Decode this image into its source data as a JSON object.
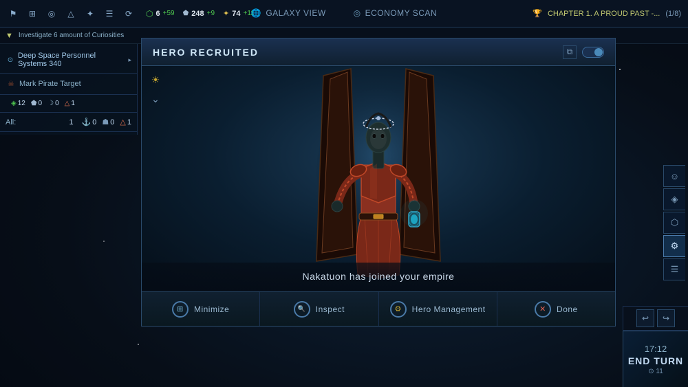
{
  "topbar": {
    "icons": [
      "⚑",
      "⊞",
      "◎",
      "△",
      "✦",
      "☰",
      "⟳"
    ],
    "resources": [
      {
        "icon": "⬡",
        "color": "#50c850",
        "value": "6",
        "delta": "+59"
      },
      {
        "icon": "⬟",
        "color": "#a0b8d0",
        "value": "248",
        "delta": "+9"
      },
      {
        "icon": "✦",
        "color": "#e0c050",
        "value": "74",
        "delta": "+11"
      }
    ],
    "nav": [
      {
        "label": "GALAXY VIEW",
        "icon": ""
      },
      {
        "label": "ECONOMY SCAN",
        "icon": "◎"
      }
    ],
    "chapter": {
      "label": "CHAPTER 1. A PROUD PAST -...",
      "progress": "(1/8)"
    }
  },
  "questbar": {
    "text": "Investigate 6 amount of Curiosities"
  },
  "sidebar": {
    "system_name": "Deep Space Personnel Systems 340",
    "pirate_label": "Mark Pirate Target",
    "stats": [
      {
        "icon": "◈",
        "value": "12",
        "color": "#50c850"
      },
      {
        "icon": "⬟",
        "value": "0",
        "color": "#a0b8d0"
      },
      {
        "icon": "☽",
        "value": "0",
        "color": "#a0c8e0"
      },
      {
        "icon": "△",
        "value": "1",
        "color": "#e07050"
      }
    ],
    "fleet_stats": {
      "all_label": "All:",
      "all_value": "1",
      "icons": [
        {
          "icon": "⚓",
          "value": "0"
        },
        {
          "icon": "☗",
          "value": "0"
        },
        {
          "icon": "△",
          "value": "1"
        }
      ]
    }
  },
  "modal": {
    "title": "HERO RECRUITED",
    "hero_name": "Nakatuon",
    "hero_message": "Nakatuon has joined your empire",
    "buttons": [
      {
        "id": "minimize",
        "label": "Minimize",
        "icon": "⊞"
      },
      {
        "id": "inspect",
        "label": "Inspect",
        "icon": "🔍"
      },
      {
        "id": "hero-management",
        "label": "Hero Management",
        "icon": "⚙"
      },
      {
        "id": "done",
        "label": "Done",
        "icon": "✕"
      }
    ]
  },
  "right_panel": {
    "buttons": [
      {
        "id": "heroes",
        "icon": "☺",
        "active": false
      },
      {
        "id": "ships",
        "icon": "◈",
        "active": false
      },
      {
        "id": "colonies",
        "icon": "⬡",
        "active": false
      },
      {
        "id": "settings",
        "icon": "⚙",
        "active": true
      },
      {
        "id": "misc",
        "icon": "☰",
        "active": false
      }
    ]
  },
  "end_turn": {
    "time": "17:12",
    "label": "END TURN",
    "turn": "⊙ 11"
  }
}
